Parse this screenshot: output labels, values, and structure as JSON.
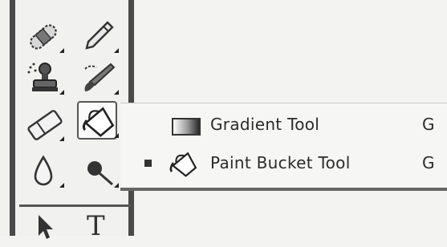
{
  "toolbar": {
    "tools": [
      {
        "name": "spot-healing-brush-icon"
      },
      {
        "name": "brush-icon"
      },
      {
        "name": "clone-stamp-icon"
      },
      {
        "name": "history-brush-icon"
      },
      {
        "name": "eraser-icon"
      },
      {
        "name": "paint-bucket-icon",
        "selected": true
      },
      {
        "name": "blur-icon"
      },
      {
        "name": "dodge-icon"
      },
      {
        "name": "move-selection-icon"
      },
      {
        "name": "type-icon",
        "glyph": "T"
      }
    ]
  },
  "flyout": {
    "items": [
      {
        "label": "Gradient Tool",
        "shortcut": "G",
        "icon": "gradient-icon",
        "active": false
      },
      {
        "label": "Paint Bucket Tool",
        "shortcut": "G",
        "icon": "paint-bucket-icon",
        "active": true
      }
    ]
  }
}
